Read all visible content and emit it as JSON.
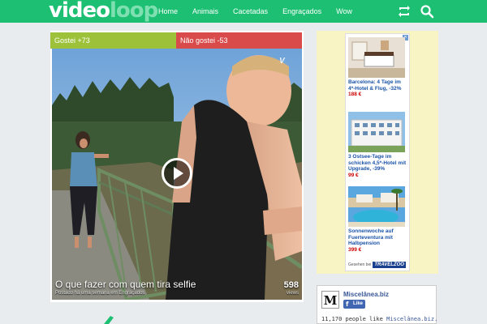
{
  "header": {
    "logo_part1": "video",
    "logo_part2": "loop",
    "nav": [
      "Home",
      "Animais",
      "Cacetadas",
      "Engraçados",
      "Wow"
    ],
    "accent_color": "#1dbf73",
    "icons": [
      "repeat-icon",
      "search-icon"
    ]
  },
  "video": {
    "likes_label": "Gostei +73",
    "dislikes_label": "Não gostei -53",
    "title": "O que fazer com quem tira selfie",
    "meta": "Postado há uma semana em Engraçados",
    "views_count": "598",
    "views_label": "views",
    "watermark": "V"
  },
  "ad": {
    "items": [
      {
        "text": "Barcelona: 4 Tage im 4*-Hotel & Flug, -32%",
        "price": "188 €"
      },
      {
        "text": "3 Ostsee-Tage im schicken 4,5*-Hotel mit Upgrade, -39%",
        "price": "99 €"
      },
      {
        "text": "Sonnenwoche auf Fuerteventura mit Halbpension",
        "price": "399 €"
      }
    ],
    "footer_label": "Gesehen bei",
    "brand": "TRAVELZOO"
  },
  "fb": {
    "logo_letter": "M",
    "page_name": "Miscelânea.biz",
    "like_label": "Like",
    "count_text": "11,170 people like ",
    "count_link": "Miscelânea.biz."
  }
}
